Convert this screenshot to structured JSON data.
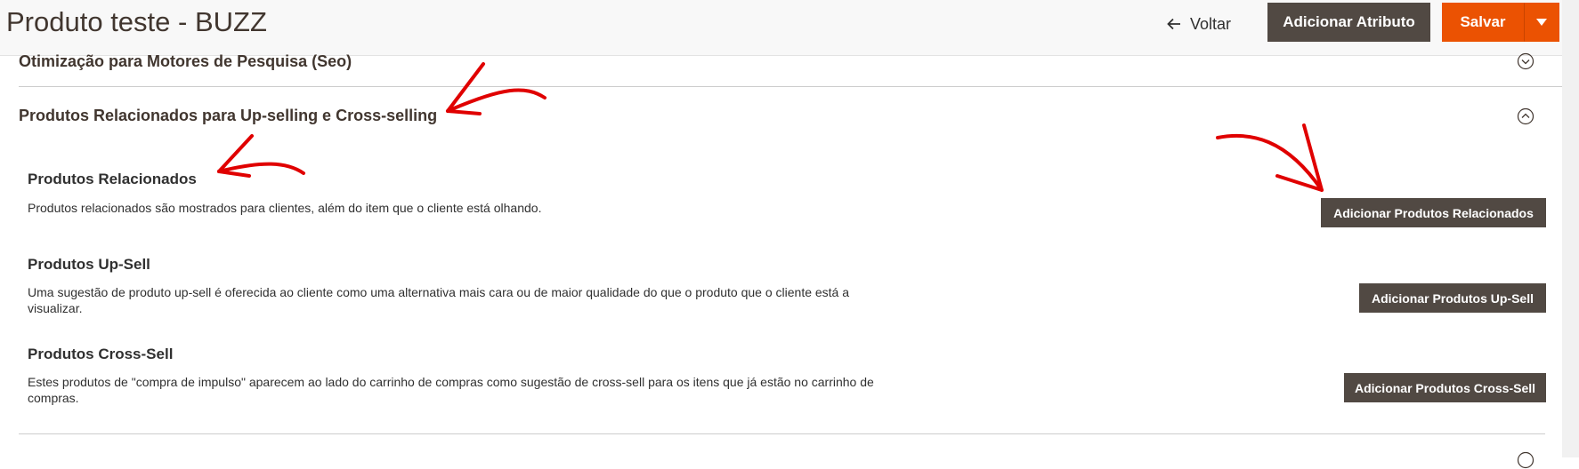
{
  "header": {
    "title": "Produto teste - BUZZ",
    "back_label": "Voltar",
    "add_attribute_label": "Adicionar Atributo",
    "save_label": "Salvar"
  },
  "sections": {
    "seo": {
      "title": "Otimização para Motores de Pesquisa (Seo)"
    },
    "related": {
      "title": "Produtos Relacionados para Up-selling e Cross-selling",
      "blocks": [
        {
          "title": "Produtos Relacionados",
          "description": "Produtos relacionados são mostrados para clientes, além do item que o cliente está olhando.",
          "button": "Adicionar Produtos Relacionados"
        },
        {
          "title": "Produtos Up-Sell",
          "description_line1": "Uma sugestão de produto up-sell é oferecida ao cliente como uma alternativa mais cara ou de maior qualidade do que o produto que o cliente está a",
          "description_line2": "visualizar.",
          "button": "Adicionar Produtos Up-Sell"
        },
        {
          "title": "Produtos Cross-Sell",
          "description_line1": "Estes produtos de \"compra de impulso\" aparecem ao lado do carrinho de compras como sugestão de cross-sell para os itens que já estão no carrinho de",
          "description_line2": "compras.",
          "button": "Adicionar Produtos Cross-Sell"
        }
      ]
    }
  },
  "colors": {
    "primary": "#eb5202",
    "secondary": "#514943",
    "annotation": "#e00000"
  },
  "icons": {
    "back": "arrow-left-icon",
    "save_menu": "caret-down-icon",
    "seo_toggle": "chevron-down-circle-icon",
    "related_toggle": "chevron-up-circle-icon",
    "annotations": "red-arrow-annotation"
  }
}
